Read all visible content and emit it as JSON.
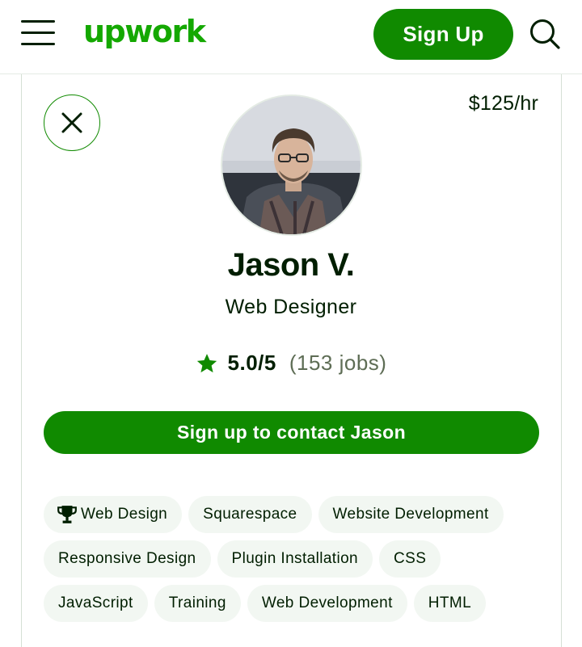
{
  "header": {
    "menu_icon": "hamburger-menu-icon",
    "logo_text": "upwork",
    "signup_label": "Sign Up",
    "search_icon": "search-icon"
  },
  "profile": {
    "close_icon": "close-icon",
    "rate": "$125/hr",
    "name": "Jason V.",
    "title": "Web Designer",
    "rating_score": "5.0/5",
    "rating_jobs": "(153 jobs)",
    "contact_label": "Sign up to contact Jason",
    "skills": [
      {
        "label": "Web Design",
        "icon": "trophy-icon"
      },
      {
        "label": "Squarespace"
      },
      {
        "label": "Website Development"
      },
      {
        "label": "Responsive Design"
      },
      {
        "label": "Plugin Installation"
      },
      {
        "label": "CSS"
      },
      {
        "label": "JavaScript"
      },
      {
        "label": "Training"
      },
      {
        "label": "Web Development"
      },
      {
        "label": "HTML"
      }
    ]
  },
  "colors": {
    "brand_green": "#14a800",
    "button_green": "#108a00",
    "text_dark": "#001e00",
    "chip_bg": "#f2f7f2"
  }
}
